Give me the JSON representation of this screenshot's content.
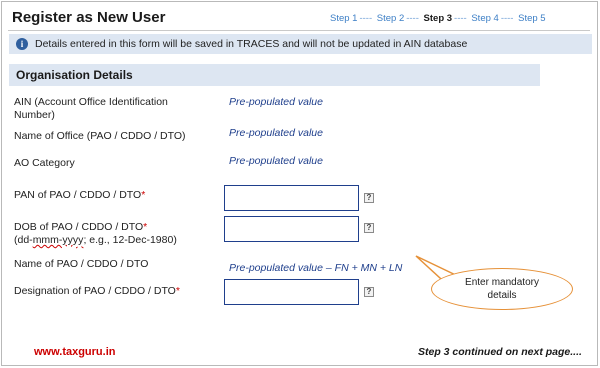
{
  "header": {
    "title": "Register as New User",
    "steps": [
      {
        "label": "Step 1",
        "current": false
      },
      {
        "label": "Step 2",
        "current": false
      },
      {
        "label": "Step 3",
        "current": true
      },
      {
        "label": "Step 4",
        "current": false
      },
      {
        "label": "Step 5",
        "current": false
      }
    ],
    "step_separator": "----"
  },
  "info": {
    "icon": "info-icon",
    "text": "Details entered in this form will be saved in TRACES and will not be updated in AIN database"
  },
  "section": {
    "title": "Organisation Details"
  },
  "fields": {
    "ain": {
      "label_line1": "AIN (Account Office Identification",
      "label_line2": "Number)",
      "value": "Pre-populated value"
    },
    "office_name": {
      "label": "Name of Office (PAO / CDDO / DTO)",
      "value": "Pre-populated value"
    },
    "ao_category": {
      "label": "AO Category",
      "value": "Pre-populated value"
    },
    "pan": {
      "label": "PAN of PAO / CDDO / DTO",
      "required_mark": "*",
      "input_value": ""
    },
    "dob": {
      "label": "DOB of PAO / CDDO / DTO",
      "required_mark": "*",
      "hint_prefix": "(dd-",
      "hint_squiggle": "mmm-yyyy",
      "hint_suffix": "; e.g., 12-Dec-1980)",
      "input_value": ""
    },
    "pao_name": {
      "label": "Name of PAO / CDDO / DTO",
      "value": "Pre-populated value – FN + MN + LN"
    },
    "designation": {
      "label": "Designation of PAO / CDDO / DTO",
      "required_mark": "*",
      "input_value": ""
    }
  },
  "help_glyph": "?",
  "callout": {
    "line1": "Enter mandatory",
    "line2": "details"
  },
  "colors": {
    "accent": "#3d7fc6",
    "section_bg": "#dde6f2",
    "required": "#cc0000",
    "value_text": "#1f3f8c",
    "callout_border": "#e69138"
  },
  "footer": {
    "watermark": "www.taxguru.in",
    "note": "Step 3 continued on next page...."
  }
}
